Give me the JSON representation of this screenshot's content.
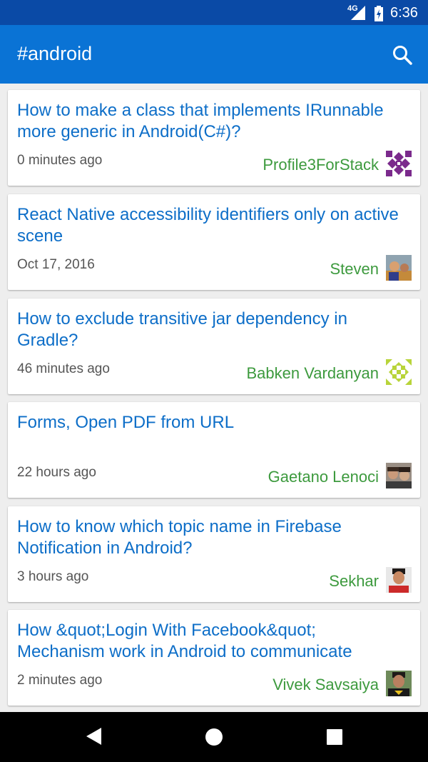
{
  "status_bar": {
    "network": "4G",
    "time": "6:36",
    "icons": [
      "signal-icon",
      "battery-charging-icon"
    ]
  },
  "app_bar": {
    "title": "#android",
    "search_icon": "search-icon"
  },
  "questions": [
    {
      "title": "How to make a class that implements IRunnable more generic in Android(C#)?",
      "time": "0 minutes ago",
      "author": "Profile3ForStack",
      "avatar": "identicon-purple"
    },
    {
      "title": "React Native accessibility identifiers only on active scene",
      "time": "Oct 17, 2016",
      "author": "Steven",
      "avatar": "photo-avatar"
    },
    {
      "title": "How to exclude transitive jar dependency in Gradle?",
      "time": "46 minutes ago",
      "author": "Babken Vardanyan",
      "avatar": "identicon-green"
    },
    {
      "title": "Forms, Open PDF from URL",
      "time": "22 hours ago",
      "author": "Gaetano Lenoci",
      "avatar": "photo-avatar"
    },
    {
      "title": "How to know which topic name in Firebase Notification in Android?",
      "time": "3 hours ago",
      "author": "Sekhar",
      "avatar": "photo-avatar"
    },
    {
      "title": "How &quot;Login With Facebook&quot; Mechanism work in Android to communicate",
      "time": "2 minutes ago",
      "author": "Vivek Savsaiya",
      "avatar": "photo-avatar"
    }
  ],
  "nav_bar": {
    "icons": [
      "back-icon",
      "home-icon",
      "recents-icon"
    ]
  },
  "colors": {
    "status_bar": "#0a4aa6",
    "app_bar": "#0a73d5",
    "title_link": "#0d6ec8",
    "author": "#3d9a3e",
    "background": "#eeeeee"
  }
}
